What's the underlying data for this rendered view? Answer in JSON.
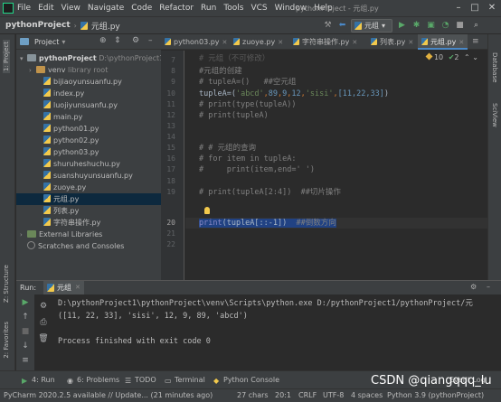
{
  "menubar": {
    "items": [
      "File",
      "Edit",
      "View",
      "Navigate",
      "Code",
      "Refactor",
      "Run",
      "Tools",
      "VCS",
      "Window",
      "Help"
    ],
    "window_title": "pythonProject - 元组.py"
  },
  "navbar": {
    "project": "pythonProject",
    "file": "元组.py",
    "run_config": "元组"
  },
  "left_strip": {
    "project_tab": "1: Project",
    "structure_tab": "Z: Structure",
    "favorites_tab": "2: Favorites"
  },
  "right_strip": {
    "database_tab": "Database",
    "sciview_tab": "SciView"
  },
  "project_panel": {
    "title": "Project",
    "root": {
      "name": "pythonProject",
      "path": "D:\\pythonProject1\\"
    },
    "venv": {
      "name": "venv",
      "note": "library root"
    },
    "files": [
      "bijiaoyunsuanfu.py",
      "index.py",
      "luojiyunsuanfu.py",
      "main.py",
      "python01.py",
      "python02.py",
      "python03.py",
      "shuruheshuchu.py",
      "suanshuyunsuanfu.py",
      "zuoye.py",
      "元组.py",
      "列表.py",
      "字符串操作.py"
    ],
    "selected_file": "元组.py",
    "external_libraries": "External Libraries",
    "scratches": "Scratches and Consoles"
  },
  "editor": {
    "tabs": [
      "python03.py",
      "zuoye.py",
      "字符串操作.py",
      "列表.py",
      "元组.py"
    ],
    "active_tab": "元组.py",
    "inspection": {
      "warnings": "10",
      "checks": "2"
    },
    "line_numbers": [
      "7",
      "8",
      "9",
      "10",
      "11",
      "12",
      "13",
      "14",
      "15",
      "16",
      "17",
      "18",
      "19",
      "20",
      "21",
      "22"
    ],
    "code": {
      "l7": "# 元组（不可修改）",
      "l8_comment": "#元组的创建",
      "l9": "# tupleA=()   ##空元组",
      "l10_var": "tupleA=(",
      "l10_s1": "'abcd'",
      "l10_n1": "89",
      "l10_n2": "9",
      "l10_n3": "12",
      "l10_s2": "'sisi'",
      "l10_list": "[11,22,33]",
      "l11": "# print(type(tupleA))",
      "l12": "# print(tupleA)",
      "l14": "# # 元组的查询",
      "l15": "# for item in tupleA:",
      "l16": "#     print(item,end=' ')",
      "l18": "# print(tupleA[2:4])  ##切片操作",
      "l20_print": "print",
      "l20_rest": "(tupleA[::-1])",
      "l20_comment": "##倒数方向"
    }
  },
  "run_panel": {
    "label": "Run:",
    "tab": "元组",
    "command": "D:\\pythonProject1\\pythonProject\\venv\\Scripts\\python.exe D:/pythonProject1/pythonProject/元",
    "output": "([11, 22, 33], 'sisi', 12, 9, 89, 'abcd')",
    "exit": "Process finished with exit code 0"
  },
  "bottom_tabs": [
    "4: Run",
    "6: Problems",
    "TODO",
    "Terminal",
    "Python Console",
    "Event Log"
  ],
  "status": {
    "message": "PyCharm 2020.2.5 available // Update... (21 minutes ago)",
    "chars": "27 chars",
    "position": "20:1",
    "line_sep": "CRLF",
    "encoding": "UTF-8",
    "indent": "4 spaces",
    "interpreter": "Python 3.9 (pythonProject)"
  },
  "watermark": "CSDN @qiangqqq_lu"
}
